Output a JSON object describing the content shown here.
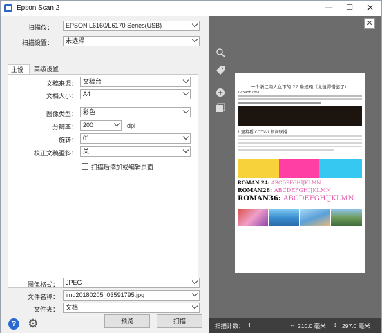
{
  "window": {
    "title": "Epson Scan 2",
    "min": "—",
    "max": "☐",
    "close": "✕"
  },
  "scanner": {
    "label": "扫描仪：",
    "value": "EPSON L6160/L6170 Series(USB)"
  },
  "scan_settings": {
    "label": "扫描设置：",
    "value": "未选择"
  },
  "tabs": [
    {
      "label": "主设置"
    },
    {
      "label": "高级设置"
    }
  ],
  "main": {
    "doc_source": {
      "label": "文稿来源：",
      "value": "文稿台"
    },
    "doc_size": {
      "label": "文档大小：",
      "value": "A4"
    },
    "image_type": {
      "label": "图像类型：",
      "value": "彩色"
    },
    "resolution": {
      "label": "分辨率：",
      "value": "200",
      "unit": "dpi"
    },
    "rotate": {
      "label": "旋转：",
      "value": "0°"
    },
    "skew": {
      "label": "校正文稿歪斜：",
      "value": "关"
    },
    "add_edit": {
      "label": "扫描后添加或编辑页面",
      "checked": false
    }
  },
  "output": {
    "format": {
      "label": "图像格式：",
      "value": "JPEG"
    },
    "filename": {
      "label": "文件名称：",
      "value": "img20180205_03591795.jpg"
    },
    "folder": {
      "label": "文件夹：",
      "value": "文档"
    }
  },
  "buttons": {
    "preview": "预览",
    "scan": "扫描"
  },
  "icons": [
    "help-icon",
    "gear-icon",
    "zoom-icon",
    "tag-icon",
    "plus-circle-icon",
    "layers-icon",
    "close-icon"
  ],
  "help_glyph": "?",
  "preview": {
    "doc_title": "一个浙江商人立下的 22 条规矩（太值得借鉴了）",
    "digits": "1234567890",
    "section_heading": "1.坚持看 CCTV-1 新闻联播",
    "roman": [
      "ROMAN 24:",
      "ROMAN28:",
      "ROMAN36:"
    ],
    "roman_tail": "ABCDEFGHIJKLMN",
    "swatch_colors": [
      "#f7d23a",
      "#ff3fa4",
      "#37c8f2",
      "#ffffff"
    ]
  },
  "status": {
    "scan_count_label": "扫描计数：",
    "scan_count": "1",
    "width": "210.0 毫米",
    "height": "297.0 毫米"
  }
}
